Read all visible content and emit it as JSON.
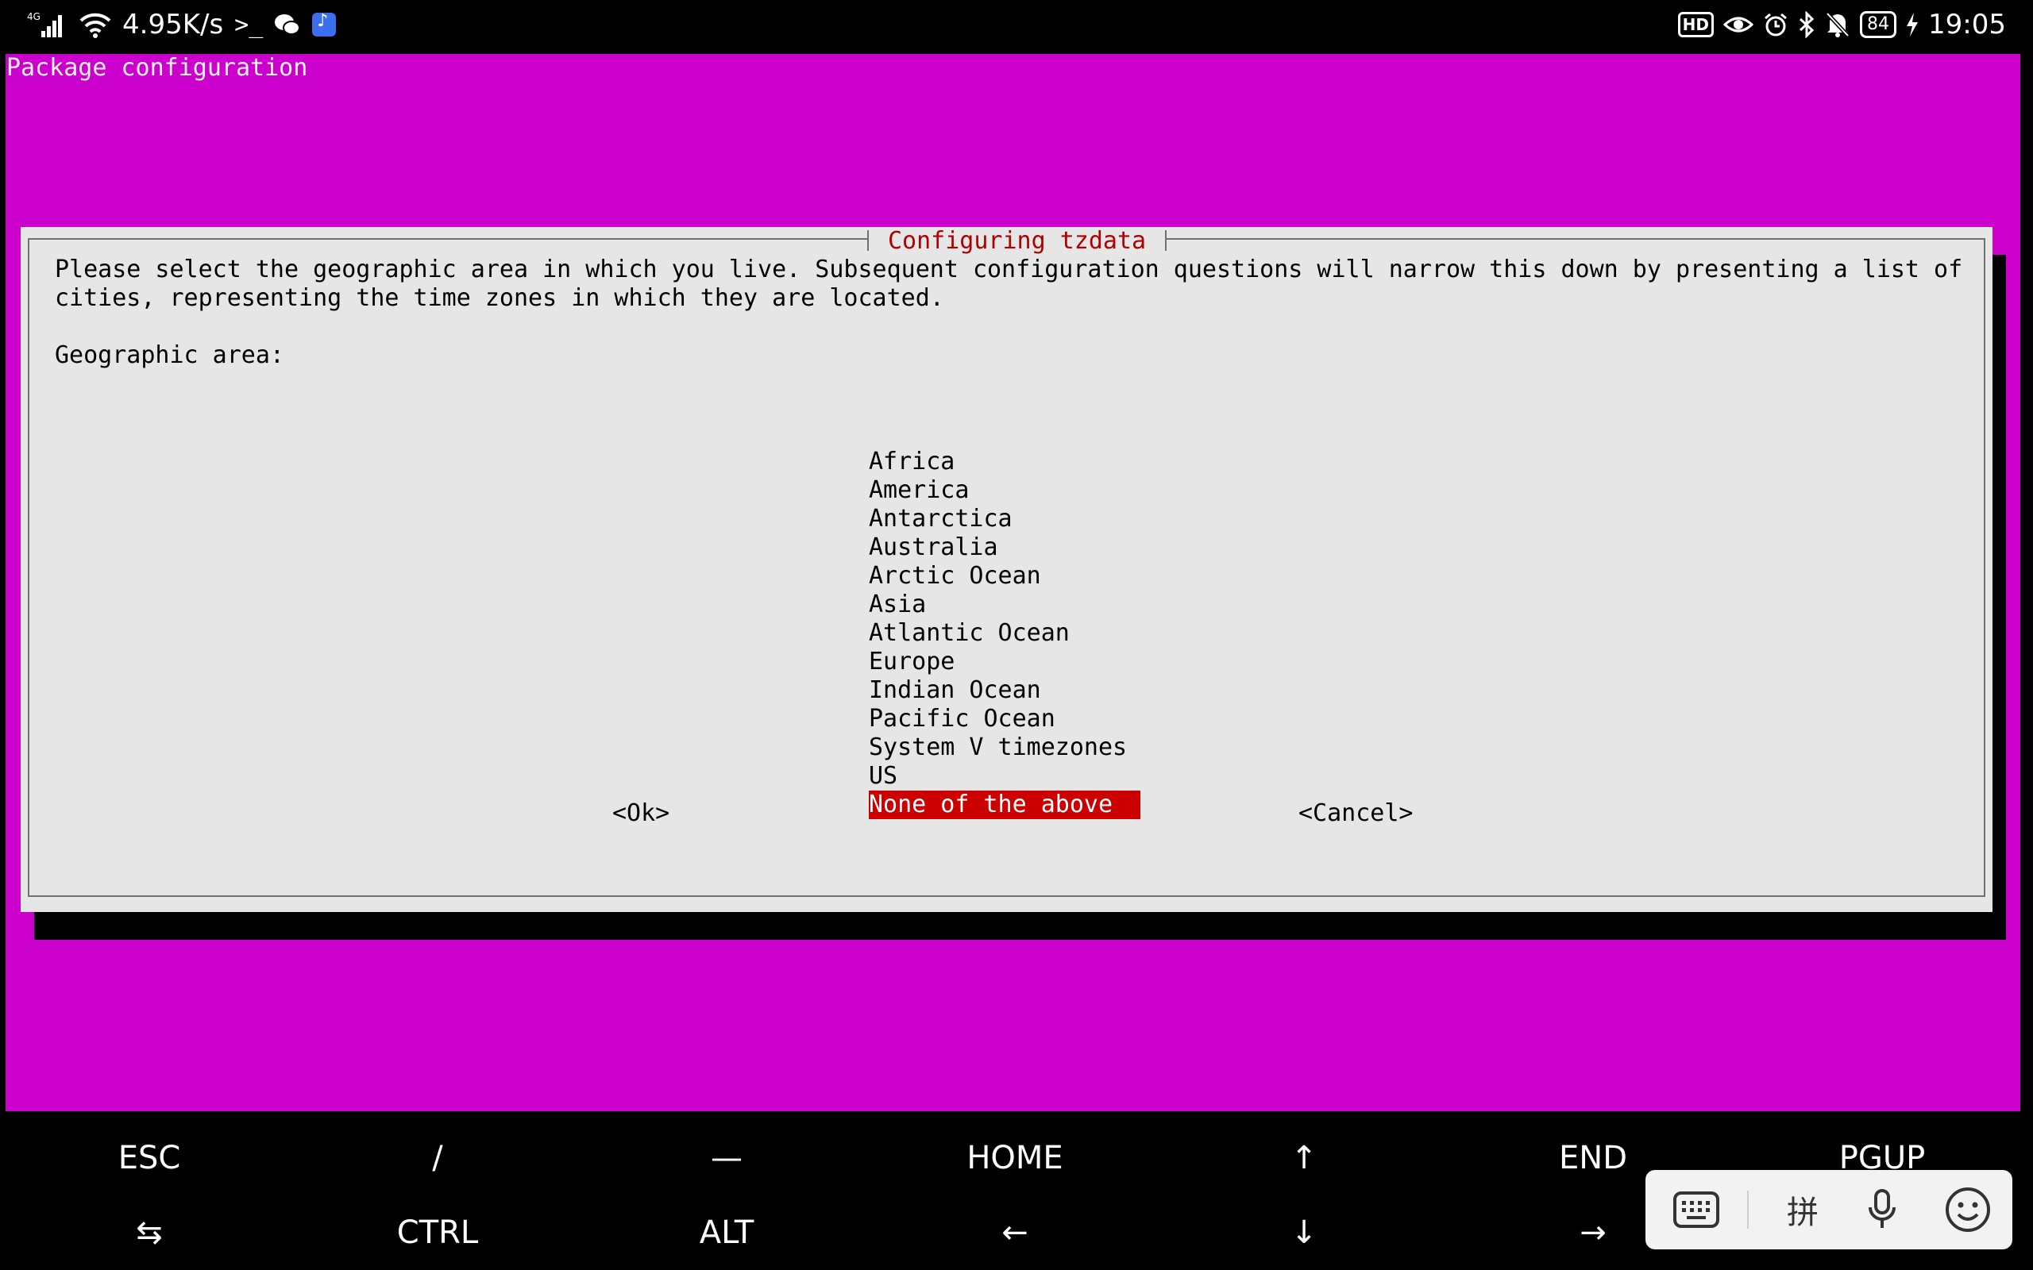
{
  "status_bar": {
    "signal_label": "4G",
    "net_speed": "4.95K/s",
    "battery": "84",
    "time": "19:05",
    "hd_badge": "HD",
    "icons": [
      "signal-icon",
      "wifi-icon",
      "terminal-icon",
      "wechat-icon",
      "music-app-icon",
      "eye-icon",
      "alarm-icon",
      "bluetooth-icon",
      "mute-icon",
      "charging-icon"
    ]
  },
  "terminal": {
    "title": "Package configuration",
    "bg_color": "#cc00cc",
    "dialog": {
      "title": "Configuring tzdata",
      "description_line1": "Please select the geographic area in which you live. Subsequent configuration questions will narrow this down by presenting a list of",
      "description_line2": "cities, representing the time zones in which they are located.",
      "prompt": "Geographic area:",
      "options": [
        "Africa",
        "America",
        "Antarctica",
        "Australia",
        "Arctic Ocean",
        "Asia",
        "Atlantic Ocean",
        "Europe",
        "Indian Ocean",
        "Pacific Ocean",
        "System V timezones",
        "US",
        "None of the above"
      ],
      "selected_option": "None of the above",
      "ok_label": "<Ok>",
      "cancel_label": "<Cancel>"
    }
  },
  "extra_keys": {
    "row1": [
      "ESC",
      "/",
      "—",
      "HOME",
      "↑",
      "END",
      "PGUP"
    ],
    "row2": [
      "⇆",
      "CTRL",
      "ALT",
      "←",
      "↓",
      "→"
    ]
  },
  "ime_toolbar": {
    "pinyin_label": "拼",
    "icons": [
      "keyboard-icon",
      "pinyin-icon",
      "microphone-icon",
      "emoji-icon"
    ]
  }
}
